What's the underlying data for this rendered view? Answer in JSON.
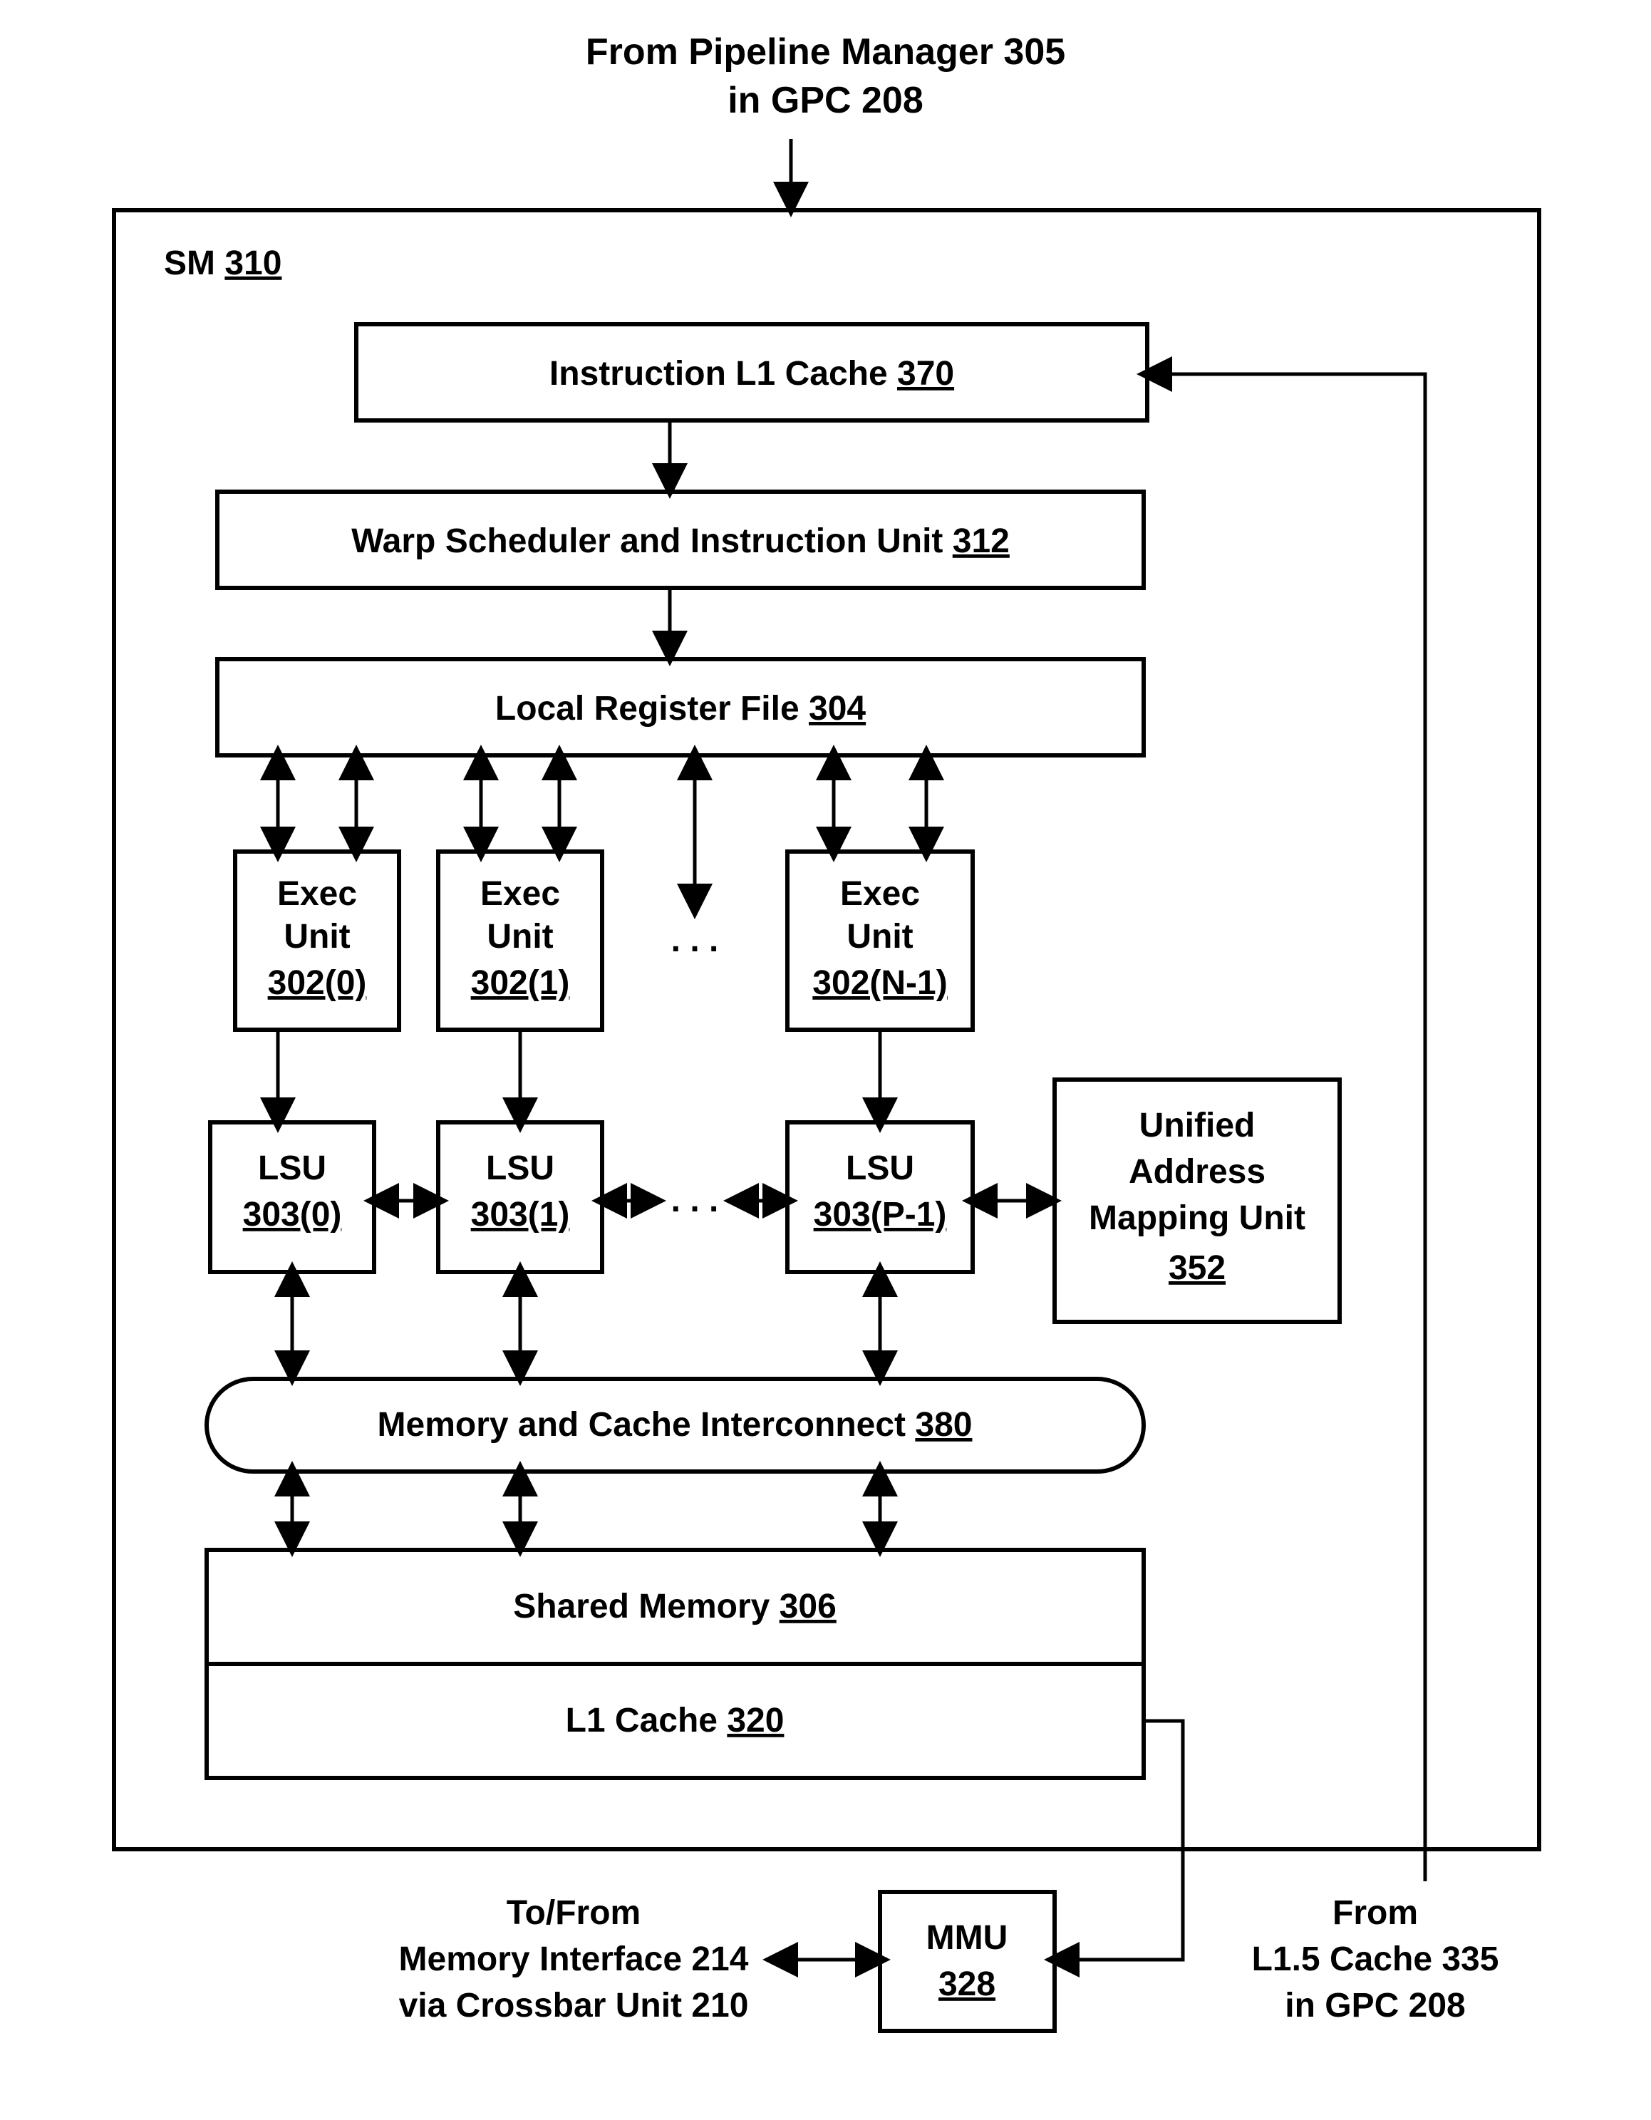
{
  "header": {
    "line1": "From Pipeline Manager 305",
    "line2": "in GPC 208"
  },
  "sm": {
    "label": "SM ",
    "num": "310"
  },
  "il1": {
    "label": "Instruction L1 Cache ",
    "num": "370"
  },
  "warp": {
    "label": "Warp Scheduler and Instruction Unit ",
    "num": "312"
  },
  "lrf": {
    "label": "Local Register File ",
    "num": "304"
  },
  "exec": [
    {
      "l1": "Exec",
      "l2": "Unit",
      "num": "302(0)"
    },
    {
      "l1": "Exec",
      "l2": "Unit",
      "num": "302(1)"
    },
    {
      "l1": "Exec",
      "l2": "Unit",
      "num": "302(N-1)"
    }
  ],
  "exec_dots": ". . .",
  "lsu": [
    {
      "l1": "LSU",
      "num": "303(0)"
    },
    {
      "l1": "LSU",
      "num": "303(1)"
    },
    {
      "l1": "LSU",
      "num": "303(P-1)"
    }
  ],
  "lsu_dots": ". . .",
  "uamu": {
    "l1": "Unified",
    "l2": "Address",
    "l3": "Mapping Unit",
    "num": "352"
  },
  "mci": {
    "label": "Memory and Cache Interconnect ",
    "num": "380"
  },
  "shm": {
    "label": "Shared Memory ",
    "num": "306"
  },
  "l1c": {
    "label": "L1 Cache ",
    "num": "320"
  },
  "mmu": {
    "l1": "MMU",
    "num": "328"
  },
  "left_caption": {
    "l1": "To/From",
    "l2": "Memory Interface 214",
    "l3": "via Crossbar Unit 210"
  },
  "right_caption": {
    "l1": "From",
    "l2": "L1.5 Cache 335",
    "l3": "in GPC 208"
  }
}
